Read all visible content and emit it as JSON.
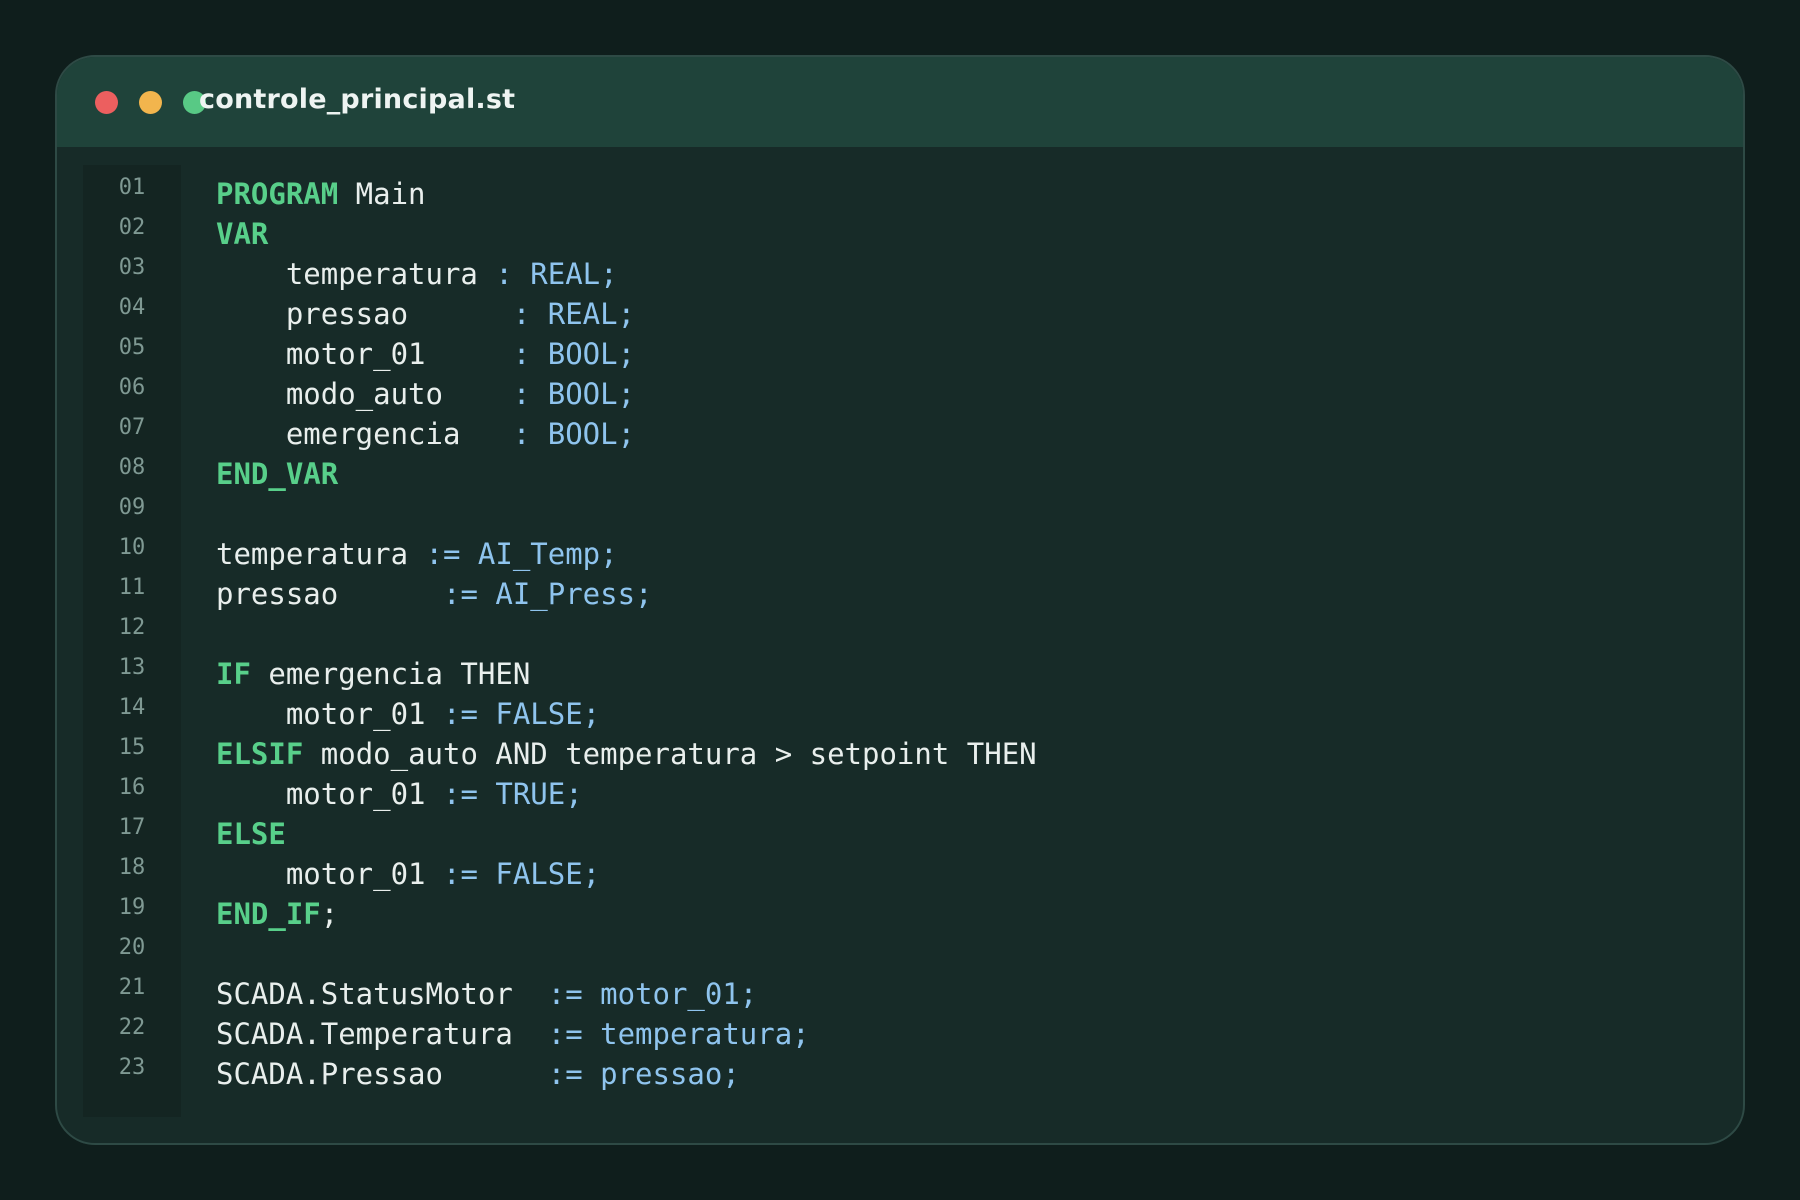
{
  "window": {
    "filename": "controle_principal.st",
    "traffic_lights": [
      "close-dot",
      "minimize-dot",
      "maximize-dot"
    ]
  },
  "colors": {
    "background": "#0f1e1c",
    "titlebar": "#1f433a",
    "editor": "#172b28",
    "keyword": "#58cf8a",
    "text": "#e9efed",
    "type": "#8fc4ee",
    "line_number": "#7f9993"
  },
  "lines": [
    {
      "n": "01",
      "segs": [
        {
          "t": "PROGRAM",
          "c": "kw"
        },
        {
          "t": " Main",
          "c": "tx"
        }
      ]
    },
    {
      "n": "02",
      "segs": [
        {
          "t": "VAR",
          "c": "kw"
        }
      ]
    },
    {
      "n": "03",
      "segs": [
        {
          "t": "    temperatura ",
          "c": "tx"
        },
        {
          "t": ": REAL;",
          "c": "ty"
        }
      ]
    },
    {
      "n": "04",
      "segs": [
        {
          "t": "    pressao      ",
          "c": "tx"
        },
        {
          "t": ": REAL;",
          "c": "ty"
        }
      ]
    },
    {
      "n": "05",
      "segs": [
        {
          "t": "    motor_01     ",
          "c": "tx"
        },
        {
          "t": ": BOOL;",
          "c": "ty"
        }
      ]
    },
    {
      "n": "06",
      "segs": [
        {
          "t": "    modo_auto    ",
          "c": "tx"
        },
        {
          "t": ": BOOL;",
          "c": "ty"
        }
      ]
    },
    {
      "n": "07",
      "segs": [
        {
          "t": "    emergencia   ",
          "c": "tx"
        },
        {
          "t": ": BOOL;",
          "c": "ty"
        }
      ]
    },
    {
      "n": "08",
      "segs": [
        {
          "t": "END_VAR",
          "c": "kw"
        }
      ]
    },
    {
      "n": "09",
      "segs": []
    },
    {
      "n": "10",
      "segs": [
        {
          "t": "temperatura ",
          "c": "tx"
        },
        {
          "t": ":= AI_Temp;",
          "c": "ty"
        }
      ]
    },
    {
      "n": "11",
      "segs": [
        {
          "t": "pressao      ",
          "c": "tx"
        },
        {
          "t": ":= AI_Press;",
          "c": "ty"
        }
      ]
    },
    {
      "n": "12",
      "segs": []
    },
    {
      "n": "13",
      "segs": [
        {
          "t": "IF",
          "c": "kw"
        },
        {
          "t": " emergencia THEN",
          "c": "tx"
        }
      ]
    },
    {
      "n": "14",
      "segs": [
        {
          "t": "    motor_01 ",
          "c": "tx"
        },
        {
          "t": ":= FALSE;",
          "c": "ty"
        }
      ]
    },
    {
      "n": "15",
      "segs": [
        {
          "t": "ELSIF",
          "c": "kw"
        },
        {
          "t": " modo_auto AND temperatura > setpoint THEN",
          "c": "tx"
        }
      ]
    },
    {
      "n": "16",
      "segs": [
        {
          "t": "    motor_01 ",
          "c": "tx"
        },
        {
          "t": ":= TRUE;",
          "c": "ty"
        }
      ]
    },
    {
      "n": "17",
      "segs": [
        {
          "t": "ELSE",
          "c": "kw"
        }
      ]
    },
    {
      "n": "18",
      "segs": [
        {
          "t": "    motor_01 ",
          "c": "tx"
        },
        {
          "t": ":= FALSE;",
          "c": "ty"
        }
      ]
    },
    {
      "n": "19",
      "segs": [
        {
          "t": "END_IF",
          "c": "kw"
        },
        {
          "t": ";",
          "c": "tx"
        }
      ]
    },
    {
      "n": "20",
      "segs": []
    },
    {
      "n": "21",
      "segs": [
        {
          "t": "SCADA.StatusMotor  ",
          "c": "tx"
        },
        {
          "t": ":= motor_01;",
          "c": "ty"
        }
      ]
    },
    {
      "n": "22",
      "segs": [
        {
          "t": "SCADA.Temperatura  ",
          "c": "tx"
        },
        {
          "t": ":= temperatura;",
          "c": "ty"
        }
      ]
    },
    {
      "n": "23",
      "segs": [
        {
          "t": "SCADA.Pressao      ",
          "c": "tx"
        },
        {
          "t": ":= pressao;",
          "c": "ty"
        }
      ]
    }
  ]
}
